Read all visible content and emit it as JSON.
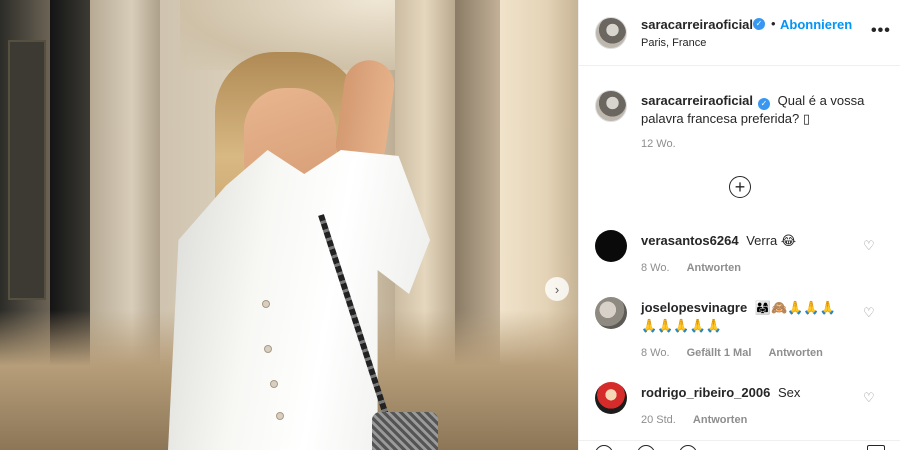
{
  "post": {
    "author": "saracarreiraoficial",
    "follow_label": "Abonnieren",
    "separator": "•",
    "location": "Paris, France",
    "more_label": "•••",
    "caption_text": "Qual é a vossa palavra francesa preferida? ▯",
    "caption_time": "12 Wo.",
    "add_label": "+",
    "next_label": "›"
  },
  "comments": [
    {
      "user": "verasantos6264",
      "text": "Verra 😂",
      "age": "8 Wo.",
      "likes": "",
      "reply_label": "Antworten"
    },
    {
      "user": "joselopesvinagre",
      "text": "👨‍👩‍👧🙈🙏🙏🙏",
      "text2": "🙏🙏🙏🙏🙏",
      "age": "8 Wo.",
      "likes": "Gefällt 1 Mal",
      "reply_label": "Antworten"
    },
    {
      "user": "rodrigo_ribeiro_2006",
      "text": "Sex",
      "age": "20 Std.",
      "likes": "",
      "reply_label": "Antworten"
    }
  ],
  "icons": {
    "verified": "verified-badge-icon",
    "heart": "heart-outline-icon",
    "add": "add-circle-icon",
    "next": "chevron-right-icon"
  },
  "colors": {
    "link": "#0095f6",
    "verified": "#3897f0",
    "muted": "#8e8e8e"
  }
}
